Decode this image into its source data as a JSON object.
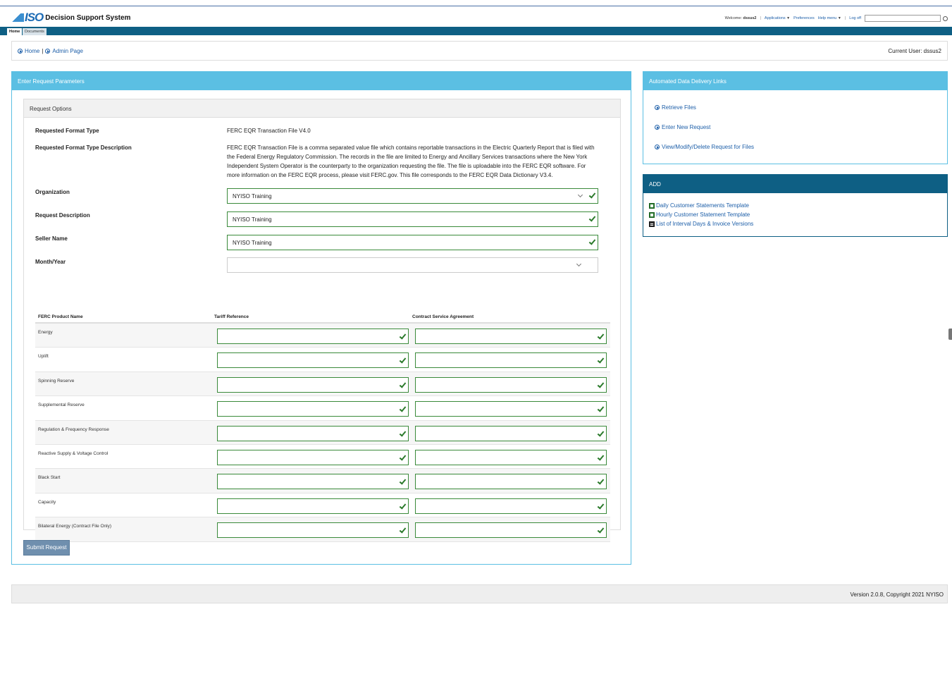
{
  "header": {
    "logo": "ISO",
    "app_title": "Decision Support System",
    "welcome_prefix": "Welcome:",
    "username": "dssus2",
    "applications": "Applications",
    "preferences": "Preferences",
    "help_menu": "Help menu",
    "log_off": "Log off"
  },
  "nav": {
    "tabs": [
      "Home",
      "Documents"
    ]
  },
  "breadcrumb": {
    "home": "Home",
    "separator": "|",
    "admin": "Admin Page",
    "current_user": "Current User: dssus2"
  },
  "main": {
    "panel_title": "Enter Request Parameters",
    "options_title": "Request Options",
    "format_type_label": "Requested Format Type",
    "format_type_value": "FERC EQR Transaction File V4.0",
    "format_desc_label": "Requested Format Type Description",
    "format_desc_value": "FERC EQR Transaction File is a comma separated value file which contains reportable transactions in the Electric Quarterly Report that is filed with the Federal Energy Regulatory Commission. The records in the file are limited to Energy and Ancillary Services transactions where the New York Independent System Operator is the counterparty to the organization requesting the file. The file is uploadable into the FERC EQR software. For more information on the FERC EQR process, please visit FERC.gov. This file corresponds to the FERC EQR Data Dictionary V3.4.",
    "organization_label": "Organization",
    "organization_value": "NYISO Training",
    "request_desc_label": "Request Description",
    "request_desc_value": "NYISO Training",
    "seller_label": "Seller Name",
    "seller_value": "NYISO Training",
    "month_label": "Month/Year",
    "month_value": "",
    "table_headers": [
      "FERC Product Name",
      "Tariff Reference",
      "Contract Service Agreement"
    ],
    "products": [
      "Energy",
      "Uplift",
      "Spinning Reserve",
      "Supplemental Reserve",
      "Regulation & Frequency Response",
      "Reactive Supply & Voltage Control",
      "Black Start",
      "Capacity",
      "Bilateral Energy (Contract File Only)"
    ],
    "submit_label": "Submit Request"
  },
  "side": {
    "panel1_title": "Automated Data Delivery Links",
    "links": [
      "Retrieve Files",
      "Enter New Request",
      "View/Modify/Delete Request for Files"
    ],
    "panel2_title": "ADD",
    "docs": [
      "Daily Customer Statements Template",
      "Hourly Customer Statement Template",
      "List of Interval Days & Invoice Versions"
    ]
  },
  "footer": {
    "version": "Version 2.0.8, Copyright 2021 NYISO"
  },
  "colors": {
    "accent": "#5bbfe3",
    "navy": "#0e5f84",
    "valid": "#2b7a2b",
    "link": "#1c5ea8"
  }
}
